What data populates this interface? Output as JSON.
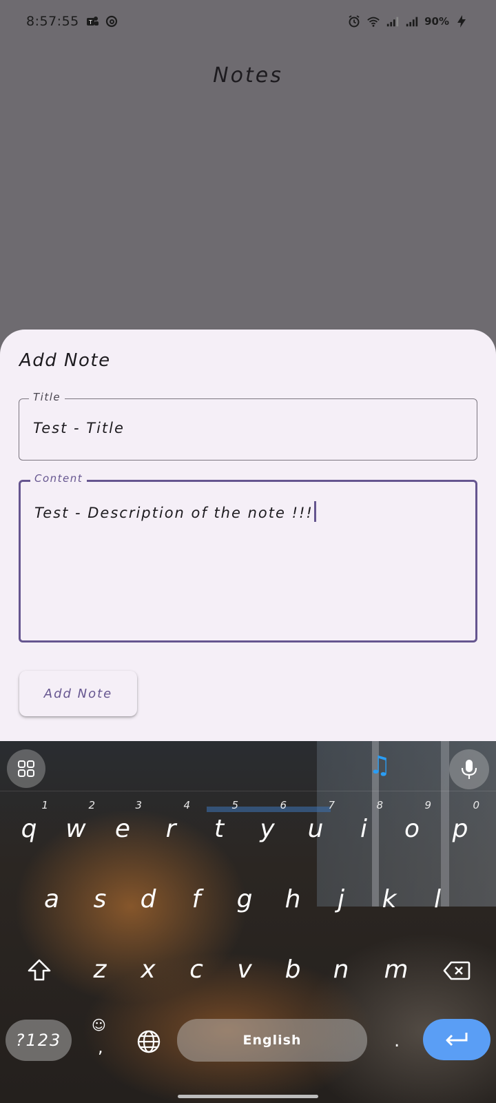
{
  "status_bar": {
    "time": "8:57:55",
    "battery": "90%"
  },
  "screen": {
    "title": "Notes"
  },
  "sheet": {
    "title": "Add Note",
    "title_field": {
      "label": "Title",
      "value": "Test - Title"
    },
    "content_field": {
      "label": "Content",
      "value": "Test - Description of the note !!!"
    },
    "add_button_label": "Add Note"
  },
  "keyboard": {
    "row1": [
      {
        "char": "q",
        "num": "1"
      },
      {
        "char": "w",
        "num": "2"
      },
      {
        "char": "e",
        "num": "3"
      },
      {
        "char": "r",
        "num": "4"
      },
      {
        "char": "t",
        "num": "5"
      },
      {
        "char": "y",
        "num": "6"
      },
      {
        "char": "u",
        "num": "7"
      },
      {
        "char": "i",
        "num": "8"
      },
      {
        "char": "o",
        "num": "9"
      },
      {
        "char": "p",
        "num": "0"
      }
    ],
    "row2": [
      "a",
      "s",
      "d",
      "f",
      "g",
      "h",
      "j",
      "k",
      "l"
    ],
    "row3": [
      "z",
      "x",
      "c",
      "v",
      "b",
      "n",
      "m"
    ],
    "symbols_label": "?123",
    "space_label": "English",
    "comma": ",",
    "period": "."
  },
  "colors": {
    "accent": "#65558f",
    "sheet_bg": "#f5eff7",
    "scrim": "#6e6b70",
    "enter_key": "#5a9ef5",
    "music_icon": "#2a9df4"
  }
}
